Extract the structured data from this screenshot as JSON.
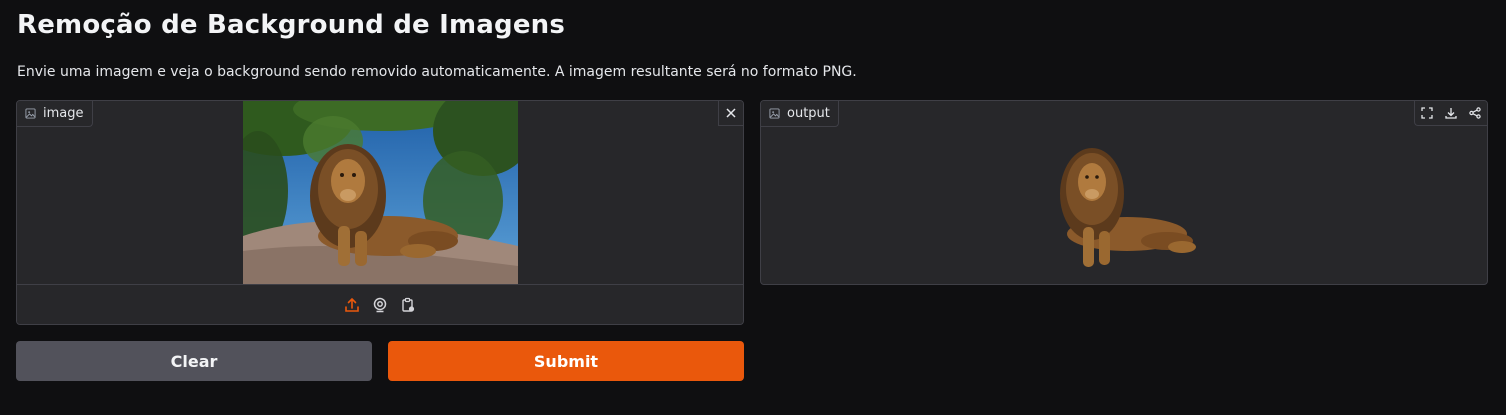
{
  "page": {
    "title": "Remoção de Background de Imagens",
    "description": "Envie uma imagem e veja o background sendo removido automaticamente. A imagem resultante será no formato PNG."
  },
  "input_panel": {
    "label": "image",
    "label_icon": "image-icon",
    "close_icon": "close-icon",
    "image_subject": "lion",
    "sources": [
      {
        "icon": "upload-icon",
        "active": true
      },
      {
        "icon": "webcam-icon",
        "active": false
      },
      {
        "icon": "clipboard-icon",
        "active": false
      }
    ]
  },
  "output_panel": {
    "label": "output",
    "label_icon": "image-icon",
    "actions": [
      "fullscreen-icon",
      "download-icon",
      "share-icon"
    ]
  },
  "buttons": {
    "clear_label": "Clear",
    "submit_label": "Submit"
  },
  "colors": {
    "background": "#0f0f11",
    "panel": "#27272a",
    "border": "#3f3f46",
    "accent": "#ea580c",
    "secondary_button": "#52525b"
  }
}
